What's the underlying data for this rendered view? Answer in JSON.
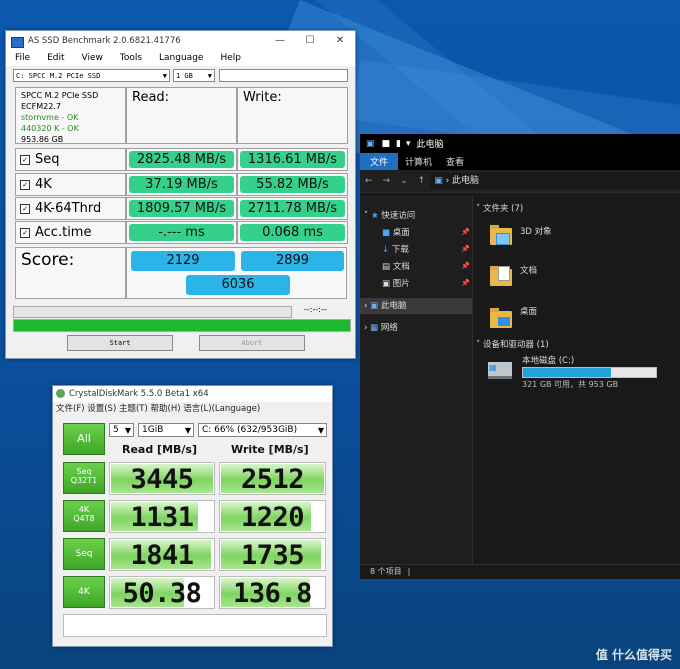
{
  "asssd": {
    "title": "AS SSD Benchmark 2.0.6821.41776",
    "menu": [
      "File",
      "Edit",
      "View",
      "Tools",
      "Language",
      "Help"
    ],
    "drive_select": "C: SPCC M.2 PCIe SSD",
    "size_select": "1 GB",
    "info": {
      "model": "SPCC M.2 PCIe SSD",
      "firmware": "ECFM22.7",
      "driver": "stornvme - OK",
      "align": "440320 K - OK",
      "capacity": "953.86 GB"
    },
    "read_header": "Read:",
    "write_header": "Write:",
    "rows": [
      {
        "label": "Seq",
        "read": "2825.48 MB/s",
        "write": "1316.61 MB/s"
      },
      {
        "label": "4K",
        "read": "37.19 MB/s",
        "write": "55.82 MB/s"
      },
      {
        "label": "4K-64Thrd",
        "read": "1809.57 MB/s",
        "write": "2711.78 MB/s"
      },
      {
        "label": "Acc.time",
        "read": "-.--- ms",
        "write": "0.068 ms"
      }
    ],
    "score_label": "Score:",
    "score_read": "2129",
    "score_write": "2899",
    "score_total": "6036",
    "timer": "--:--:--",
    "start": "Start",
    "abort": "Abort",
    "colors": {
      "result": "#35d08c",
      "score": "#2bb4e8",
      "progress": "#1db82f"
    }
  },
  "explorer": {
    "title": "此电脑",
    "ribbon": [
      "文件",
      "计算机",
      "查看"
    ],
    "address": "此电脑",
    "nav": {
      "quick_access": "快速访问",
      "desktop": "桌面",
      "downloads": "下载",
      "documents": "文档",
      "pictures": "图片",
      "this_pc": "此电脑",
      "network": "网络"
    },
    "folders_header": "文件夹 (7)",
    "folders": [
      "3D 对象",
      "文档",
      "桌面"
    ],
    "devices_header": "设备和驱动器 (1)",
    "drive_name": "本地磁盘 (C:)",
    "drive_space": "321 GB 可用，共 953 GB",
    "drive_used_fraction": 0.66,
    "status": "8 个项目"
  },
  "cdm": {
    "title": "CrystalDiskMark 5.5.0 Beta1 x64",
    "menu": [
      "文件(F)",
      "设置(S)",
      "主题(T)",
      "帮助(H)",
      "语言(L)(Language)"
    ],
    "all_button": "All",
    "count": "5",
    "size": "1GiB",
    "drive": "C: 66% (632/953GiB)",
    "read_header": "Read [MB/s]",
    "write_header": "Write [MB/s]",
    "tests": [
      {
        "label1": "Seq",
        "label2": "Q32T1",
        "read": "3445",
        "write": "2512",
        "read_fill": 1.0,
        "write_fill": 1.0
      },
      {
        "label1": "4K",
        "label2": "Q4T8",
        "read": "1131",
        "write": "1220",
        "read_fill": 0.86,
        "write_fill": 0.88
      },
      {
        "label1": "Seq",
        "label2": "",
        "read": "1841",
        "write": "1735",
        "read_fill": 0.98,
        "write_fill": 0.97
      },
      {
        "label1": "4K",
        "label2": "",
        "read": "50.38",
        "write": "136.8",
        "read_fill": 0.72,
        "write_fill": 0.87
      }
    ]
  },
  "watermark": "值 什么值得买"
}
